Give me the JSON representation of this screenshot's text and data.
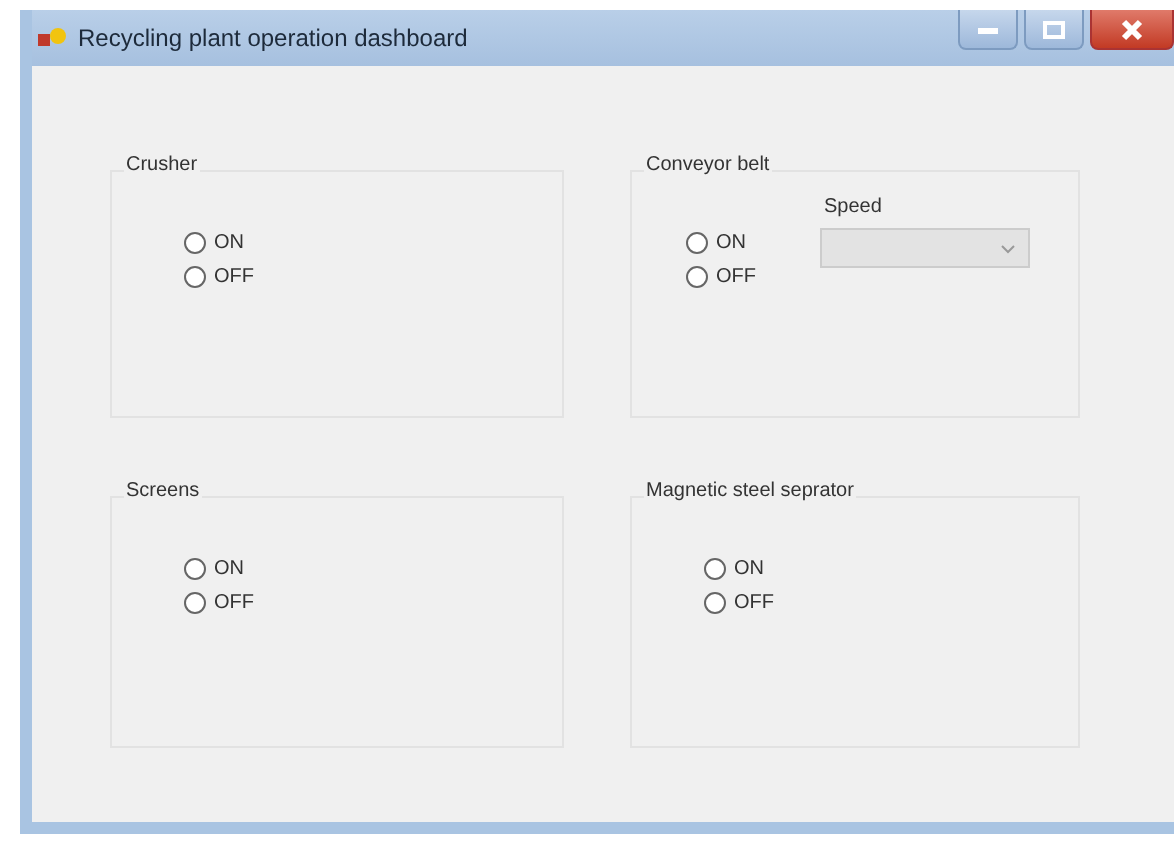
{
  "window": {
    "title": "Recycling plant operation dashboard"
  },
  "groups": [
    {
      "title": "Crusher",
      "options": [
        {
          "label": "ON",
          "selected": false
        },
        {
          "label": "OFF",
          "selected": false
        }
      ]
    },
    {
      "title": "Conveyor belt",
      "options": [
        {
          "label": "ON",
          "selected": false
        },
        {
          "label": "OFF",
          "selected": false
        }
      ],
      "speed": {
        "label": "Speed",
        "disabled": true
      }
    },
    {
      "title": "Screens",
      "options": [
        {
          "label": "ON",
          "selected": false
        },
        {
          "label": "OFF",
          "selected": false
        }
      ]
    },
    {
      "title": "Magnetic steel seprator",
      "options": [
        {
          "label": "ON",
          "selected": false
        },
        {
          "label": "OFF",
          "selected": false
        }
      ]
    }
  ]
}
